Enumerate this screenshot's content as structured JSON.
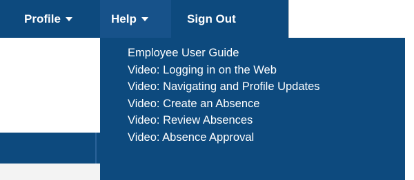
{
  "nav": {
    "profile_label": "Profile",
    "help_label": "Help",
    "signout_label": "Sign Out"
  },
  "help_menu": {
    "items": [
      {
        "label": "Employee User Guide"
      },
      {
        "label": "Video: Logging in on the Web"
      },
      {
        "label": "Video: Navigating and Profile Updates"
      },
      {
        "label": "Video: Create an Absence"
      },
      {
        "label": "Video: Review Absences"
      },
      {
        "label": "Video: Absence Approval"
      }
    ]
  },
  "colors": {
    "nav_background": "#0d4a7e",
    "active_tab": "#17528a",
    "menu_background": "#0d4a7e",
    "text": "#ffffff"
  }
}
